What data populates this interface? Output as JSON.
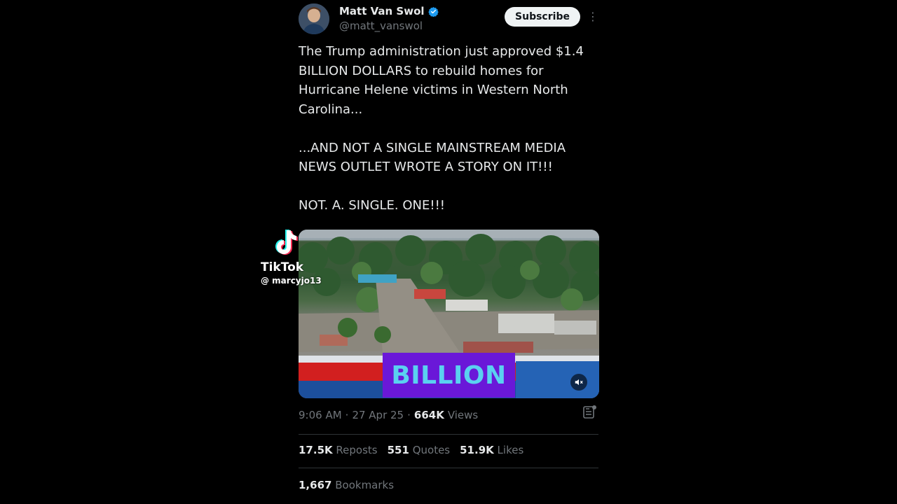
{
  "author": {
    "name": "Matt Van Swol",
    "handle": "@matt_vanswol",
    "verified": true
  },
  "subscribe_label": "Subscribe",
  "tweet_text": "The Trump administration just approved $1.4 BILLION DOLLARS to rebuild homes for Hurricane Helene victims in Western North Carolina...\n\n...AND NOT A SINGLE MAINSTREAM MEDIA NEWS OUTLET WROTE A STORY ON IT!!!\n\nNOT. A. SINGLE. ONE!!!",
  "media": {
    "overlay_word": "BILLION"
  },
  "meta": {
    "time": "9:06 AM",
    "date": "27 Apr 25",
    "views_count": "664K",
    "views_label": "Views"
  },
  "stats": {
    "reposts_count": "17.5K",
    "reposts_label": "Reposts",
    "quotes_count": "551",
    "quotes_label": "Quotes",
    "likes_count": "51.9K",
    "likes_label": "Likes",
    "bookmarks_count": "1,667",
    "bookmarks_label": "Bookmarks"
  },
  "watermark": {
    "brand": "TikTok",
    "user": "@ marcyjo13"
  },
  "colors": {
    "background": "#000000",
    "primary_text": "#e7e9ea",
    "secondary_text": "#71767b",
    "verified_blue": "#1d9bf0",
    "overlay_bg": "#6a18d8",
    "overlay_text": "#5ad1f0"
  }
}
